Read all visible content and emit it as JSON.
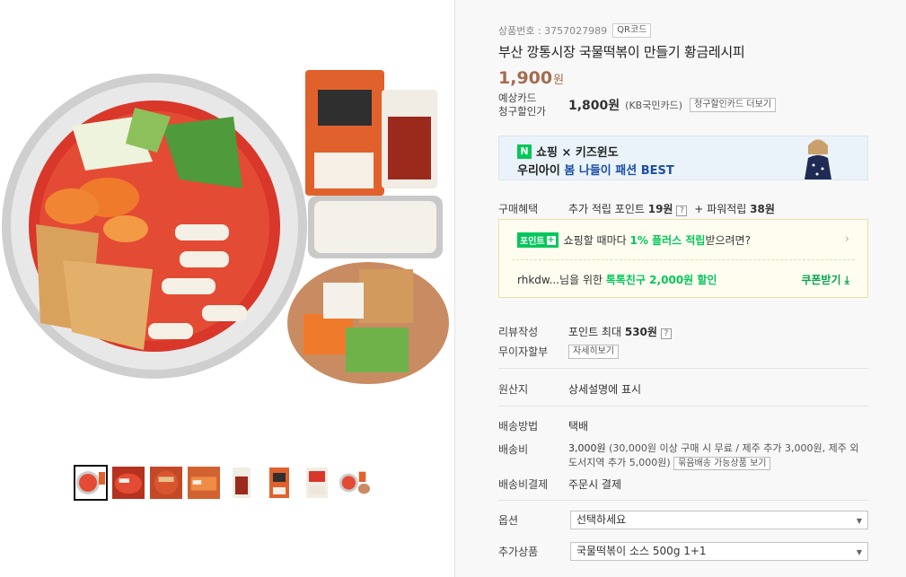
{
  "product": {
    "number_label": "상품번호 : 3757027989",
    "qr_label": "QR코드",
    "title": "부산 깡통시장 국물떡볶이 만들기 황금레시피",
    "price": "1,900",
    "price_unit": "원",
    "card_label_1": "예상카드",
    "card_label_2": "청구할인가",
    "card_price": "1,800원",
    "card_name": "(KB국민카드)",
    "card_more": "청구할인카드 더보기"
  },
  "banner": {
    "logo": "N",
    "line1": "쇼핑 × 키즈윈도",
    "line2_prefix": "우리아이 ",
    "line2_highlight": "봄 나들이 패션 BEST"
  },
  "benefit": {
    "label": "구매혜택",
    "text_prefix": "추가 적립 포인트 ",
    "points": "19원",
    "text_mid": " + 파워적립 ",
    "power_points": "38원"
  },
  "point_box": {
    "badge": "포인트",
    "text_prefix": "쇼핑할 때마다 ",
    "highlight": "1% 플러스 적립",
    "text_suffix": " 받으려면?",
    "user_text": "rhkdw...님을 위한 ",
    "user_highlight": "톡톡친구 2,000원 할인",
    "coupon": "쿠폰받기 ⤓"
  },
  "review": {
    "label": "리뷰작성",
    "text": "포인트 최대 ",
    "amount": "530원"
  },
  "installment": {
    "label": "무이자할부",
    "button": "자세히보기"
  },
  "origin": {
    "label": "원산지",
    "value": "상세설명에 표시"
  },
  "shipping": {
    "method_label": "배송방법",
    "method": "택배",
    "fee_label": "배송비",
    "fee_amount": "3,000원",
    "fee_desc": " (30,000원 이상 구매 시 무료 / 제주 추가 3,000원, 제주 외 도서지역 추가 5,000원)",
    "bundle_button": "묶음배송 가능상품 보기",
    "payment_label": "배송비결제",
    "payment": "주문시 결제"
  },
  "options": {
    "label": "옵션",
    "selected": "선택하세요",
    "extra_label": "추가상품",
    "extra_selected": "국물떡볶이 소스 500g 1+1"
  }
}
